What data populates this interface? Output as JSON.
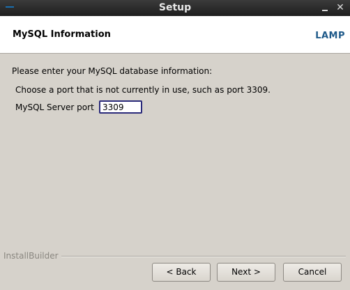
{
  "window": {
    "title": "Setup",
    "close_glyph": "✕",
    "icons": [
      "menu-icon",
      "minimize-icon",
      "close-icon"
    ]
  },
  "header": {
    "page_title": "MySQL Information",
    "logo": "LAMP"
  },
  "main": {
    "intro": "Please enter your MySQL database information:",
    "hint": "Choose a port that is not currently in use, such as port 3309.",
    "port_label": "MySQL Server port",
    "port_value": "3309"
  },
  "footer": {
    "brand": "InstallBuilder",
    "back_label": "< Back",
    "next_label": "Next >",
    "cancel_label": "Cancel"
  },
  "colors": {
    "titlebar": "#2c2c2c",
    "background": "#d6d2cb",
    "logo": "#1f5a8a",
    "input_border": "#2a2a7a"
  }
}
